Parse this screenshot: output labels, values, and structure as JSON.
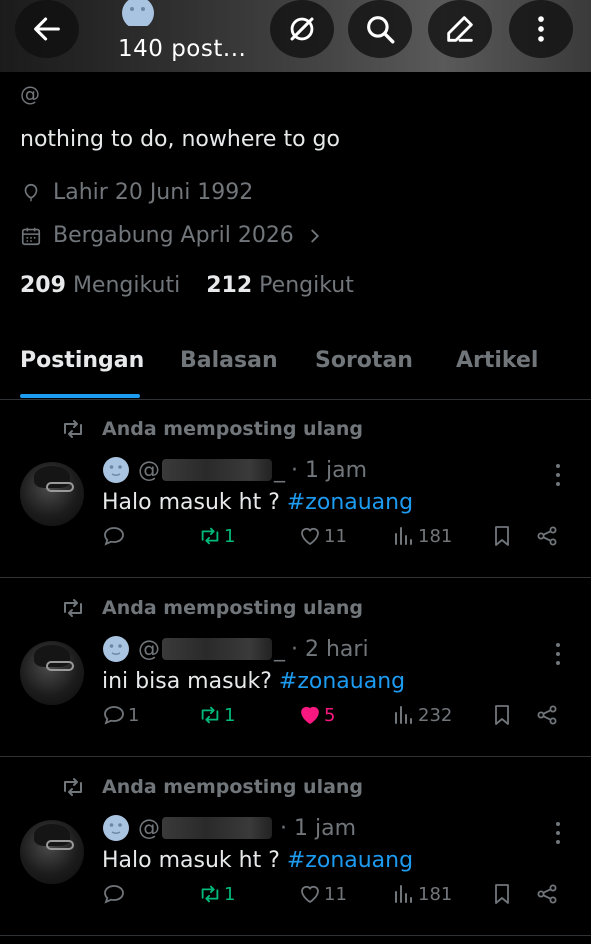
{
  "header": {
    "title": "140 post...",
    "icons": [
      "back-arrow-icon",
      "grok-icon",
      "search-icon",
      "compose-icon",
      "more-vertical-icon"
    ]
  },
  "profile": {
    "handle": "@",
    "bio": "nothing to do, nowhere to go",
    "birth": "Lahir 20 Juni 1992",
    "joined": "Bergabung April 2026",
    "following_count": "209",
    "following_label": "Mengikuti",
    "followers_count": "212",
    "followers_label": "Pengikut"
  },
  "tabs": [
    {
      "label": "Postingan",
      "active": true
    },
    {
      "label": "Balasan",
      "active": false
    },
    {
      "label": "Sorotan",
      "active": false
    },
    {
      "label": "Artikel",
      "active": false
    }
  ],
  "colors": {
    "accent": "#1d9bf0",
    "repost": "#00ba7c",
    "like": "#f91880",
    "muted": "#71767b"
  },
  "posts": [
    {
      "repost_label": "Anda memposting ulang",
      "handle": "@",
      "handle_end": "_",
      "time": "· 1 jam",
      "text": "Halo masuk ht ? ",
      "hashtag": "#zonauang",
      "replies": "",
      "reposts": "1",
      "likes": "11",
      "views": "181",
      "liked": false
    },
    {
      "repost_label": "Anda memposting ulang",
      "handle": "@",
      "handle_end": "_",
      "time": "· 2 hari",
      "text": "ini bisa masuk? ",
      "hashtag": "#zonauang",
      "replies": "1",
      "reposts": "1",
      "likes": "5",
      "views": "232",
      "liked": true
    },
    {
      "repost_label": "Anda memposting ulang",
      "handle": "@",
      "handle_end": "",
      "time": "· 1 jam",
      "text": "Halo masuk ht ? ",
      "hashtag": "#zonauang",
      "replies": "",
      "reposts": "1",
      "likes": "11",
      "views": "181",
      "liked": false
    }
  ]
}
